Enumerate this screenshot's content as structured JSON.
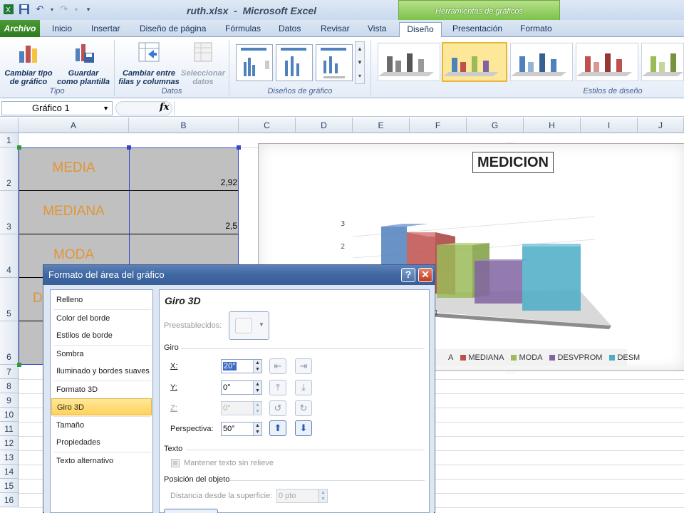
{
  "window": {
    "title": "ruth.xlsx  -  Microsoft Excel",
    "context_group": "Herramientas de gráficos"
  },
  "tabs": {
    "file": "Archivo",
    "items": [
      "Inicio",
      "Insertar",
      "Diseño de página",
      "Fórmulas",
      "Datos",
      "Revisar",
      "Vista",
      "Diseño",
      "Presentación",
      "Formato"
    ],
    "active": "Diseño"
  },
  "ribbon": {
    "tipo": {
      "label": "Tipo",
      "btn1": [
        "Cambiar tipo",
        "de gráfico"
      ],
      "btn2": [
        "Guardar",
        "como plantilla"
      ]
    },
    "datos": {
      "label": "Datos",
      "btn1": [
        "Cambiar entre",
        "filas y columnas"
      ],
      "btn2": [
        "Seleccionar",
        "datos"
      ]
    },
    "disenos": {
      "label": "Diseños de gráfico"
    },
    "estilos": {
      "label": "Estilos de diseño"
    },
    "style_colors": [
      "#6b6b6b",
      "#4f81bd",
      "#4f81bd",
      "#c0504d",
      "#9bbb59"
    ]
  },
  "formula_bar": {
    "name_box": "Gráfico 1",
    "fx": "fx"
  },
  "columns": [
    "A",
    "B",
    "C",
    "D",
    "E",
    "F",
    "G",
    "H",
    "I",
    "J"
  ],
  "rows": [
    "1",
    "2",
    "3",
    "4",
    "5",
    "6",
    "7",
    "8",
    "9",
    "10",
    "11",
    "12",
    "13",
    "14",
    "15",
    "16"
  ],
  "cells": [
    {
      "label": "MEDIA",
      "value": "2,92"
    },
    {
      "label": "MEDIANA",
      "value": "2,5"
    },
    {
      "label": "MODA",
      "value": ""
    },
    {
      "label": "D",
      "value": ""
    }
  ],
  "chart": {
    "title": "MEDICION",
    "y_ticks": [
      "3",
      "2"
    ],
    "x_label_partial": "1",
    "legend": [
      {
        "name": "A",
        "color": "#4f81bd"
      },
      {
        "name": "MEDIANA",
        "color": "#c0504d"
      },
      {
        "name": "MODA",
        "color": "#9bbb59"
      },
      {
        "name": "DESVPROM",
        "color": "#8064a2"
      },
      {
        "name": "DESM",
        "color": "#4bacc6"
      }
    ]
  },
  "dialog": {
    "title": "Formato del área del gráfico",
    "help": "?",
    "close": "✕",
    "categories": [
      "Relleno",
      "Color del borde",
      "Estilos de borde",
      "Sombra",
      "Iluminado y bordes suaves",
      "Formato 3D",
      "Giro 3D",
      "Tamaño",
      "Propiedades",
      "Texto alternativo"
    ],
    "selected_category": "Giro 3D",
    "panel": {
      "heading": "Giro 3D",
      "presets_label": "Preestablecidos:",
      "giro_label": "Giro",
      "x_label": "X:",
      "x_value": "20°",
      "y_label": "Y:",
      "y_value": "0°",
      "z_label": "Z:",
      "z_value": "0°",
      "perspective_label": "Perspectiva:",
      "perspective_value": "50°",
      "text_group": "Texto",
      "keep_flat": "Mantener texto sin relieve",
      "position_group": "Posición del objeto",
      "distance_label": "Distancia desde la superficie:",
      "distance_value": "0 pto"
    }
  }
}
